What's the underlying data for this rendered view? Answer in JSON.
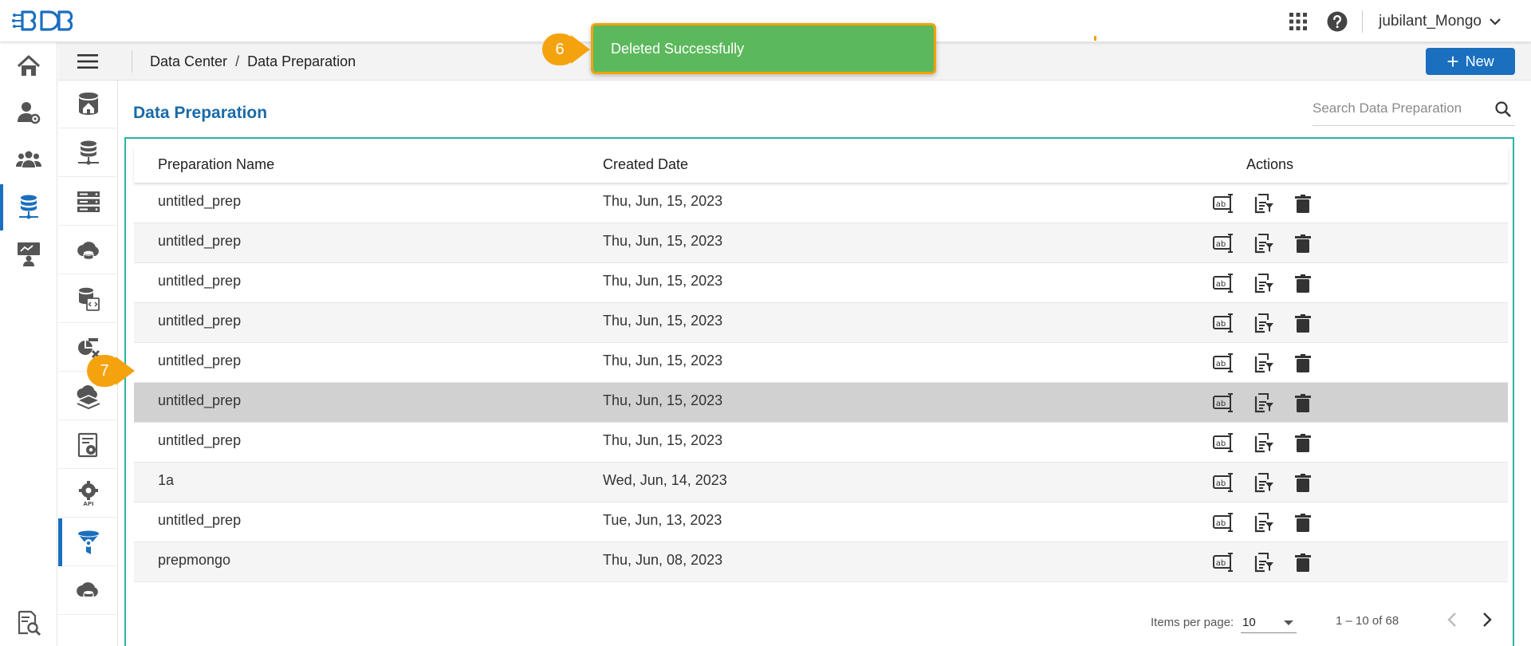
{
  "app": {
    "logo_text": "BDB",
    "user_name": "jubilant_Mongo"
  },
  "breadcrumb": {
    "items": [
      "Data Center",
      "Data Preparation"
    ],
    "separator": "/"
  },
  "toolbar": {
    "new_label": "New",
    "new_icon": "+"
  },
  "page": {
    "title": "Data Preparation",
    "search_placeholder": "Search Data Preparation"
  },
  "toast": {
    "message": "Deleted Successfully"
  },
  "callouts": {
    "toast_step": "6",
    "row_step": "7"
  },
  "rail": {
    "items": [
      "home-icon",
      "user-settings-icon",
      "users-group-icon",
      "database-icon",
      "presentation-user-icon"
    ],
    "bottom_item": "document-search-icon",
    "active_index": 3
  },
  "subsidebar": {
    "items": [
      "data-store-home-icon",
      "data-connector-icon",
      "server-list-icon",
      "data-sets-icon",
      "data-as-api-icon",
      "data-sandbox-icon",
      "cloud-stack-icon",
      "settings-report-icon",
      "api-gear-icon",
      "data-preparation-icon",
      "data-cloud-icon"
    ],
    "active_index": 9
  },
  "table": {
    "headers": {
      "name": "Preparation Name",
      "date": "Created Date",
      "actions": "Actions"
    },
    "rows": [
      {
        "name": "untitled_prep",
        "date": "Thu, Jun, 15, 2023"
      },
      {
        "name": "untitled_prep",
        "date": "Thu, Jun, 15, 2023"
      },
      {
        "name": "untitled_prep",
        "date": "Thu, Jun, 15, 2023"
      },
      {
        "name": "untitled_prep",
        "date": "Thu, Jun, 15, 2023"
      },
      {
        "name": "untitled_prep",
        "date": "Thu, Jun, 15, 2023"
      },
      {
        "name": "untitled_prep",
        "date": "Thu, Jun, 15, 2023"
      },
      {
        "name": "untitled_prep",
        "date": "Thu, Jun, 15, 2023"
      },
      {
        "name": "1a",
        "date": "Wed, Jun, 14, 2023"
      },
      {
        "name": "untitled_prep",
        "date": "Tue, Jun, 13, 2023"
      },
      {
        "name": "prepmongo",
        "date": "Thu, Jun, 08, 2023"
      }
    ],
    "row_actions": [
      "rename-icon",
      "edit-preparation-icon",
      "delete-icon"
    ],
    "highlighted_row": 5
  },
  "pagination": {
    "items_per_page_label": "Items per page:",
    "items_per_page_value": "10",
    "range_label": "1 – 10 of 68"
  },
  "colors": {
    "accent": "#1a6fbe",
    "title_blue": "#1a6aa8",
    "toast_green": "#5cb85c",
    "callout_orange": "#f5a20f",
    "panel_border": "#2bb3a3",
    "row_highlight": "#d1d1d1"
  }
}
